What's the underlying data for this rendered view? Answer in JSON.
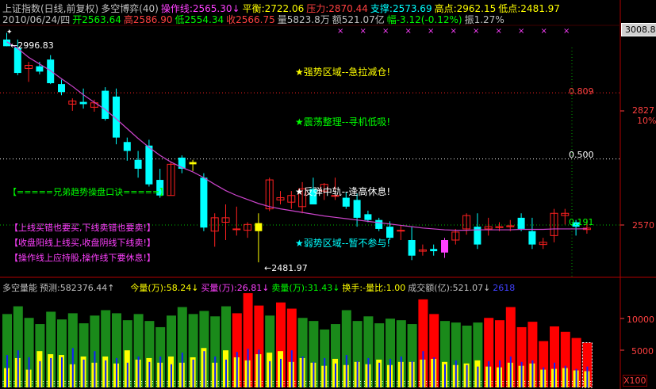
{
  "header": {
    "line1": [
      {
        "text": "上证指数(日线,前复权)",
        "color": "#c0c0c0"
      },
      {
        "text": "多空博弈(40)",
        "color": "#c0c0c0"
      },
      {
        "text": "操作线:2565.30↓",
        "color": "#ff40ff"
      },
      {
        "text": "平衡:2722.06",
        "color": "#ffff00"
      },
      {
        "text": "压力:2870.44",
        "color": "#ff4040"
      },
      {
        "text": "支撑:2573.69",
        "color": "#00ffff"
      },
      {
        "text": "高点:2962.15",
        "color": "#ffff00"
      },
      {
        "text": "低点:2481.97",
        "color": "#ffff00"
      }
    ],
    "line2": [
      {
        "text": "2010/06/24/四",
        "color": "#c0c0c0"
      },
      {
        "text": "开2563.64",
        "color": "#00ff00"
      },
      {
        "text": "高2586.90",
        "color": "#ff4040"
      },
      {
        "text": "低2554.34",
        "color": "#00ff00"
      },
      {
        "text": "收2566.75",
        "color": "#ff4040"
      },
      {
        "text": "量5823.8万",
        "color": "#c0c0c0"
      },
      {
        "text": "额521.07亿",
        "color": "#c0c0c0"
      },
      {
        "text": "幅-3.12(-0.12%)",
        "color": "#00ff00"
      },
      {
        "text": "振1.27%",
        "color": "#c0c0c0"
      }
    ]
  },
  "axis_right": {
    "top_box": "3008.8",
    "labels": [
      {
        "text": "2827",
        "color": "#ff4040"
      },
      {
        "text": "10%",
        "color": "#ff4040"
      },
      {
        "text": "2570",
        "color": "#ff4040"
      }
    ]
  },
  "fib_labels": [
    "0.809",
    "0.500",
    "0.191"
  ],
  "annotations": {
    "high_label": "2996.83",
    "low_label": "←2481.97",
    "zones": [
      {
        "text": "★强势区域--急拉减仓!",
        "color": "#ffff00"
      },
      {
        "text": "★震荡整理--寻机低吸!",
        "color": "#00ff00"
      },
      {
        "text": "★反弹中轨--逢高休息!",
        "color": "#ffffff"
      },
      {
        "text": "★弱势区域--暂不参与!",
        "color": "#00ffff"
      }
    ],
    "tips_title": "【=====兄弟趋势操盘口诀=====】",
    "tips": [
      "【上线买错也要买,下线卖错也要卖!】",
      "【收盘阳线上线买,收盘阴线下线卖!】",
      "【操作线上应持股,操作线下要休息!】"
    ]
  },
  "volume_header": [
    {
      "text": "多空量能",
      "color": "#c0c0c0"
    },
    {
      "text": "预测:582376.44↑",
      "color": "#c0c0c0"
    },
    {
      "text": "今量(万):58.24↓",
      "color": "#ffff00"
    },
    {
      "text": "买量(万):26.81↓",
      "color": "#ff40ff"
    },
    {
      "text": "卖量(万):31.43↓",
      "color": "#00ff00"
    },
    {
      "text": "换手:-量比:1.00",
      "color": "#ffff00"
    },
    {
      "text": "成交额(亿):521.07↓",
      "color": "#c0c0c0"
    },
    {
      "text": "2618",
      "color": "#4040ff"
    }
  ],
  "volume_axis": {
    "labels": [
      "10000",
      "5000"
    ],
    "unit": "X100"
  },
  "colors": {
    "up": "#ff2020",
    "down": "#00ffff",
    "ma": "#cc44cc",
    "frame": "#b00000",
    "zero": "#ffffff"
  },
  "chart_data": {
    "type": "candlestick",
    "ylim": [
      2460,
      3020
    ],
    "fib_levels": [
      {
        "ratio": "0.809",
        "value": 2870.44
      },
      {
        "ratio": "0.500",
        "value": 2722.06
      },
      {
        "ratio": "0.191",
        "value": 2573.69
      }
    ],
    "candles": [
      {
        "o": 2990,
        "h": 3005,
        "l": 2975,
        "c": 2975
      },
      {
        "o": 2972,
        "h": 2990,
        "l": 2910,
        "c": 2915
      },
      {
        "o": 2925,
        "h": 2940,
        "l": 2895,
        "c": 2932
      },
      {
        "o": 2930,
        "h": 2940,
        "l": 2912,
        "c": 2918
      },
      {
        "o": 2945,
        "h": 2955,
        "l": 2890,
        "c": 2892
      },
      {
        "o": 2890,
        "h": 2900,
        "l": 2865,
        "c": 2872
      },
      {
        "o": 2845,
        "h": 2858,
        "l": 2830,
        "c": 2852
      },
      {
        "o": 2850,
        "h": 2880,
        "l": 2835,
        "c": 2845
      },
      {
        "o": 2838,
        "h": 2855,
        "l": 2828,
        "c": 2848
      },
      {
        "o": 2875,
        "h": 2883,
        "l": 2808,
        "c": 2812
      },
      {
        "o": 2862,
        "h": 2880,
        "l": 2755,
        "c": 2770
      },
      {
        "o": 2760,
        "h": 2770,
        "l": 2718,
        "c": 2740
      },
      {
        "o": 2720,
        "h": 2740,
        "l": 2680,
        "c": 2700
      },
      {
        "o": 2752,
        "h": 2765,
        "l": 2660,
        "c": 2665
      },
      {
        "o": 2675,
        "h": 2700,
        "l": 2635,
        "c": 2640
      },
      {
        "o": 2640,
        "h": 2715,
        "l": 2640,
        "c": 2710
      },
      {
        "o": 2725,
        "h": 2730,
        "l": 2690,
        "c": 2700
      },
      {
        "o": 2710,
        "h": 2720,
        "l": 2695,
        "c": 2715
      },
      {
        "o": 2680,
        "h": 2690,
        "l": 2560,
        "c": 2568
      },
      {
        "o": 2560,
        "h": 2600,
        "l": 2525,
        "c": 2590
      },
      {
        "o": 2580,
        "h": 2620,
        "l": 2540,
        "c": 2590
      },
      {
        "o": 2565,
        "h": 2615,
        "l": 2550,
        "c": 2565
      },
      {
        "o": 2562,
        "h": 2580,
        "l": 2545,
        "c": 2575
      },
      {
        "o": 2560,
        "h": 2600,
        "l": 2490,
        "c": 2578
      },
      {
        "o": 2610,
        "h": 2680,
        "l": 2605,
        "c": 2675
      },
      {
        "o": 2630,
        "h": 2650,
        "l": 2620,
        "c": 2635
      },
      {
        "o": 2625,
        "h": 2650,
        "l": 2610,
        "c": 2640
      },
      {
        "o": 2615,
        "h": 2670,
        "l": 2600,
        "c": 2655
      },
      {
        "o": 2655,
        "h": 2680,
        "l": 2620,
        "c": 2620
      },
      {
        "o": 2650,
        "h": 2668,
        "l": 2630,
        "c": 2665
      },
      {
        "o": 2640,
        "h": 2680,
        "l": 2630,
        "c": 2640
      },
      {
        "o": 2635,
        "h": 2648,
        "l": 2610,
        "c": 2615
      },
      {
        "o": 2630,
        "h": 2645,
        "l": 2570,
        "c": 2590
      },
      {
        "o": 2598,
        "h": 2606,
        "l": 2580,
        "c": 2585
      },
      {
        "o": 2585,
        "h": 2590,
        "l": 2560,
        "c": 2565
      },
      {
        "o": 2570,
        "h": 2582,
        "l": 2540,
        "c": 2545
      },
      {
        "o": 2560,
        "h": 2572,
        "l": 2540,
        "c": 2562
      },
      {
        "o": 2540,
        "h": 2570,
        "l": 2495,
        "c": 2505
      },
      {
        "o": 2515,
        "h": 2530,
        "l": 2505,
        "c": 2518
      },
      {
        "o": 2520,
        "h": 2530,
        "l": 2505,
        "c": 2515
      },
      {
        "o": 2512,
        "h": 2545,
        "l": 2500,
        "c": 2540
      },
      {
        "o": 2540,
        "h": 2565,
        "l": 2530,
        "c": 2558
      },
      {
        "o": 2565,
        "h": 2600,
        "l": 2552,
        "c": 2595
      },
      {
        "o": 2570,
        "h": 2600,
        "l": 2520,
        "c": 2530
      },
      {
        "o": 2565,
        "h": 2590,
        "l": 2550,
        "c": 2570
      },
      {
        "o": 2568,
        "h": 2580,
        "l": 2560,
        "c": 2570
      },
      {
        "o": 2570,
        "h": 2585,
        "l": 2560,
        "c": 2572
      },
      {
        "o": 2590,
        "h": 2600,
        "l": 2560,
        "c": 2565
      },
      {
        "o": 2560,
        "h": 2590,
        "l": 2520,
        "c": 2530
      },
      {
        "o": 2530,
        "h": 2545,
        "l": 2520,
        "c": 2535
      },
      {
        "o": 2550,
        "h": 2610,
        "l": 2535,
        "c": 2600
      },
      {
        "o": 2595,
        "h": 2610,
        "l": 2575,
        "c": 2600
      },
      {
        "o": 2580,
        "h": 2585,
        "l": 2550,
        "c": 2570
      },
      {
        "o": 2563.64,
        "h": 2586.9,
        "l": 2554.34,
        "c": 2566.75
      }
    ],
    "ma": [
      2985,
      2970,
      2950,
      2935,
      2920,
      2902,
      2885,
      2866,
      2849,
      2833,
      2812,
      2790,
      2768,
      2748,
      2730,
      2715,
      2703,
      2693,
      2680,
      2665,
      2651,
      2640,
      2631,
      2622,
      2615,
      2610,
      2606,
      2602,
      2598,
      2594,
      2591,
      2588,
      2585,
      2582,
      2579,
      2576,
      2573,
      2570,
      2567,
      2565,
      2563,
      2562,
      2562,
      2563,
      2563,
      2563,
      2563,
      2564,
      2564,
      2564,
      2565,
      2565,
      2565,
      2565.3
    ],
    "volume": {
      "ylim": [
        0,
        12000
      ],
      "bars": [
        {
          "v": 9500,
          "c": "green",
          "y": 2500,
          "b": 4200
        },
        {
          "v": 10500,
          "c": "green",
          "y": 3800,
          "b": 4800
        },
        {
          "v": 9000,
          "c": "green",
          "y": 2300,
          "b": 3900
        },
        {
          "v": 8200,
          "c": "green",
          "y": 4700,
          "b": 3400
        },
        {
          "v": 9800,
          "c": "green",
          "y": 4300,
          "b": 3800
        },
        {
          "v": 8800,
          "c": "green",
          "y": 4200,
          "b": 3900
        },
        {
          "v": 9600,
          "c": "green",
          "y": 3000,
          "b": 5100
        },
        {
          "v": 8300,
          "c": "green",
          "y": 4000,
          "b": 3600
        },
        {
          "v": 9300,
          "c": "green",
          "y": 3200,
          "b": 4700
        },
        {
          "v": 10000,
          "c": "green",
          "y": 4000,
          "b": 3500
        },
        {
          "v": 9600,
          "c": "green",
          "y": 3100,
          "b": 3800
        },
        {
          "v": 8700,
          "c": "green",
          "y": 4800,
          "b": 3200
        },
        {
          "v": 9500,
          "c": "green",
          "y": 3600,
          "b": 4000
        },
        {
          "v": 8600,
          "c": "green",
          "y": 3800,
          "b": 3300
        },
        {
          "v": 7800,
          "c": "green",
          "y": 3200,
          "b": 4000
        },
        {
          "v": 9300,
          "c": "green",
          "y": 4000,
          "b": 3000
        },
        {
          "v": 10400,
          "c": "green",
          "y": 3200,
          "b": 4500
        },
        {
          "v": 9500,
          "c": "green",
          "y": 3900,
          "b": 3600
        },
        {
          "v": 9900,
          "c": "green",
          "y": 5100,
          "b": 4700
        },
        {
          "v": 9200,
          "c": "green",
          "y": 3200,
          "b": 4000
        },
        {
          "v": 10500,
          "c": "green",
          "y": 4800,
          "b": 3600
        },
        {
          "v": 9600,
          "c": "red",
          "y": 3900,
          "b": 4600
        },
        {
          "v": 12200,
          "c": "red",
          "y": 3500,
          "b": 5000
        },
        {
          "v": 10600,
          "c": "red",
          "y": 4300,
          "b": 4900
        },
        {
          "v": 9300,
          "c": "green",
          "y": 4500,
          "b": 3400
        },
        {
          "v": 11000,
          "c": "red",
          "y": 4700,
          "b": 3700
        },
        {
          "v": 10200,
          "c": "red",
          "y": 3300,
          "b": 4800
        },
        {
          "v": 9000,
          "c": "green",
          "y": 3800,
          "b": 4000
        },
        {
          "v": 8600,
          "c": "green",
          "y": 3200,
          "b": 3300
        },
        {
          "v": 7500,
          "c": "green",
          "y": 2800,
          "b": 3800
        },
        {
          "v": 8200,
          "c": "green",
          "y": 3700,
          "b": 3100
        },
        {
          "v": 10000,
          "c": "green",
          "y": 2900,
          "b": 4200
        },
        {
          "v": 8600,
          "c": "green",
          "y": 3300,
          "b": 3400
        },
        {
          "v": 9200,
          "c": "green",
          "y": 3000,
          "b": 3800
        },
        {
          "v": 8300,
          "c": "green",
          "y": 3600,
          "b": 3200
        },
        {
          "v": 8900,
          "c": "green",
          "y": 2900,
          "b": 3700
        },
        {
          "v": 8700,
          "c": "green",
          "y": 3300,
          "b": 4000
        },
        {
          "v": 8200,
          "c": "green",
          "y": 3300,
          "b": 3400
        },
        {
          "v": 11400,
          "c": "red",
          "y": 3600,
          "b": 4700
        },
        {
          "v": 9500,
          "c": "red",
          "y": 3700,
          "b": 3900
        },
        {
          "v": 8600,
          "c": "green",
          "y": 3300,
          "b": 3000
        },
        {
          "v": 8400,
          "c": "green",
          "y": 2900,
          "b": 3500
        },
        {
          "v": 8000,
          "c": "green",
          "y": 3100,
          "b": 2900
        },
        {
          "v": 8400,
          "c": "green",
          "y": 3500,
          "b": 2700
        },
        {
          "v": 9000,
          "c": "red",
          "y": 2700,
          "b": 3400
        },
        {
          "v": 8700,
          "c": "red",
          "y": 2600,
          "b": 3500
        },
        {
          "v": 10400,
          "c": "red",
          "y": 3200,
          "b": 4000
        },
        {
          "v": 7800,
          "c": "red",
          "y": 2800,
          "b": 3300
        },
        {
          "v": 8500,
          "c": "red",
          "y": 3100,
          "b": 3500
        },
        {
          "v": 6000,
          "c": "red",
          "y": 2300,
          "b": 2600
        },
        {
          "v": 7900,
          "c": "red",
          "y": 2400,
          "b": 3200
        },
        {
          "v": 7200,
          "c": "red",
          "y": 2500,
          "b": 2800
        },
        {
          "v": 6400,
          "c": "red",
          "y": 2200,
          "b": 2400
        },
        {
          "v": 5800,
          "c": "outline",
          "y": 2100,
          "b": 2700
        }
      ]
    }
  }
}
